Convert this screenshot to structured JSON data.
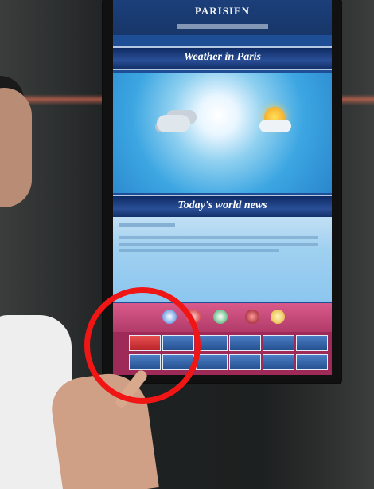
{
  "kiosk": {
    "brand": "PARISIEN",
    "weather_title": "Weather in Paris",
    "news_title": "Today's world news"
  },
  "colors": {
    "highlight_circle": "#f01616",
    "active_tab": "#d63a3a",
    "tab_blue": "#2f63ad",
    "panel_pink": "#b13b6a"
  },
  "icons": [
    "weather-cloudy-icon",
    "weather-sunny-icon",
    "category-dot-icons"
  ]
}
